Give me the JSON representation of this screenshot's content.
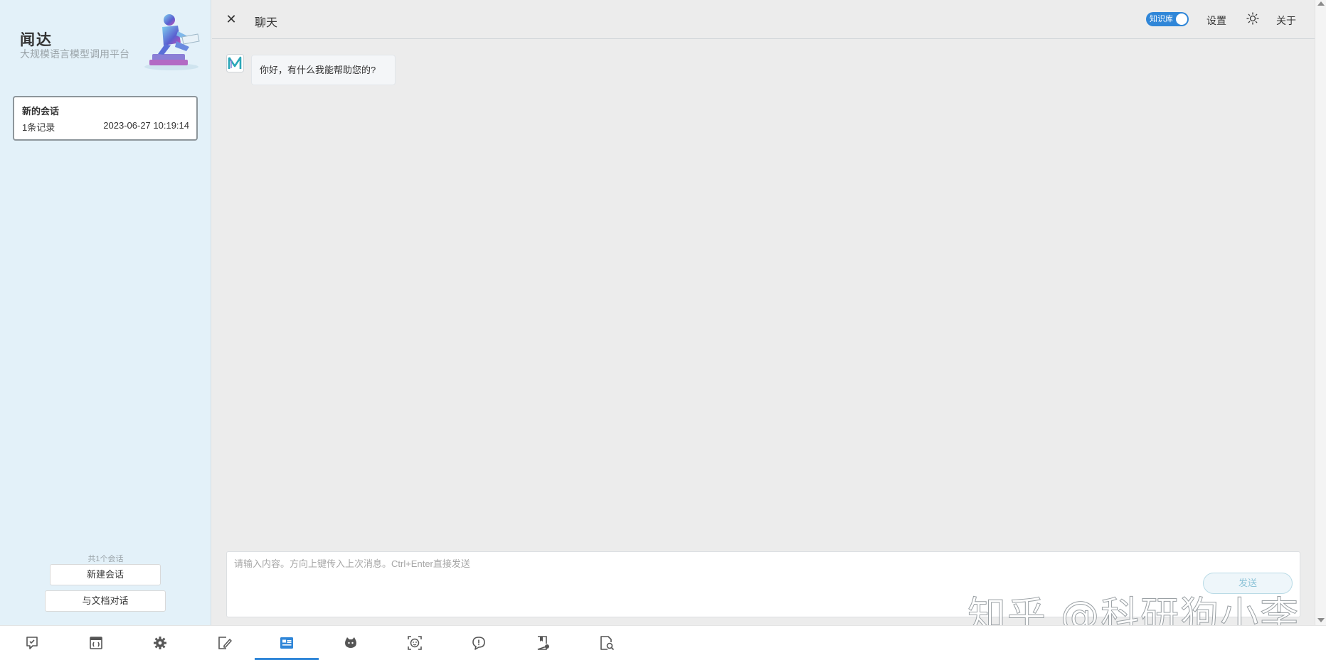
{
  "sidebar": {
    "brand_title": "闻达",
    "brand_subtitle": "大规模语言模型调用平台",
    "sessions": [
      {
        "title": "新的会话",
        "count": "1条记录",
        "time": "2023-06-27 10:19:14"
      }
    ],
    "session_total": "共1个会话",
    "new_session_label": "新建会话",
    "doc_chat_label": "与文档对话"
  },
  "header": {
    "title": "聊天",
    "kb_toggle_label": "知识库",
    "kb_toggle_on": true,
    "settings_label": "设置",
    "theme_icon": "sun-icon",
    "about_label": "关于"
  },
  "chat": {
    "messages": [
      {
        "role": "assistant",
        "text": "你好，有什么我能帮助您的?"
      }
    ]
  },
  "input": {
    "placeholder": "请输入内容。方向上键传入上次消息。Ctrl+Enter直接发送",
    "value": "",
    "send_label": "发送"
  },
  "watermark": "知乎 @科研狗小李",
  "toolbar": {
    "items": [
      {
        "icon": "check-note-icon",
        "active": false
      },
      {
        "icon": "book-icon",
        "active": false
      },
      {
        "icon": "gear-icon",
        "active": false
      },
      {
        "icon": "edit-doc-icon",
        "active": false
      },
      {
        "icon": "chat-list-icon",
        "active": true
      },
      {
        "icon": "cat-icon",
        "active": false
      },
      {
        "icon": "face-scan-icon",
        "active": false
      },
      {
        "icon": "message-icon",
        "active": false
      },
      {
        "icon": "bookmark-doc-icon",
        "active": false
      },
      {
        "icon": "doc-search-icon",
        "active": false
      }
    ],
    "active_color": "#2f86d8"
  },
  "colors": {
    "sidebar_bg": "#e3f1f9",
    "main_bg": "#ececec",
    "accent": "#2f86d8"
  }
}
